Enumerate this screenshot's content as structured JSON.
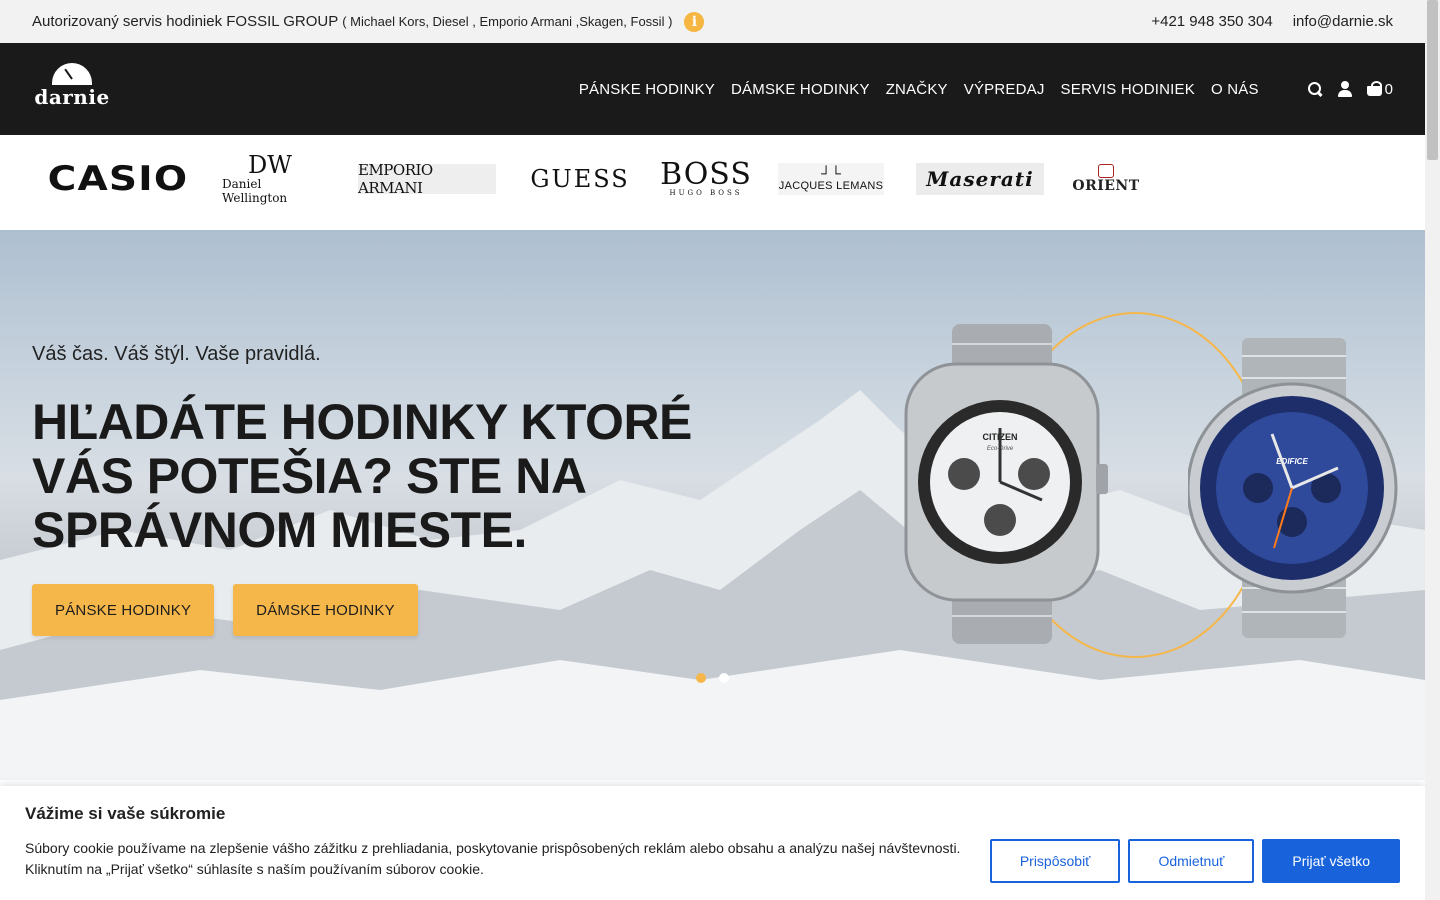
{
  "topbar": {
    "info_main": "Autorizovaný servis hodiniek FOSSIL GROUP",
    "info_brands": "( Michael Kors, Diesel , Emporio Armani ,Skagen, Fossil )",
    "info_icon": "info-icon",
    "phone": "+421 948 350 304",
    "email": "info@darnie.sk"
  },
  "header": {
    "logo_text": "darnie",
    "nav": [
      {
        "label": "PÁNSKE HODINKY"
      },
      {
        "label": "DÁMSKE HODINKY"
      },
      {
        "label": "ZNAČKY"
      },
      {
        "label": "VÝPREDAJ"
      },
      {
        "label": "SERVIS HODINIEK"
      },
      {
        "label": "O NÁS"
      }
    ],
    "icons": [
      "search-icon",
      "user-icon",
      "cart-icon"
    ],
    "cart_count": "0"
  },
  "brands": {
    "casio": "CASIO",
    "dw_mark": "DW",
    "dw_name": "Daniel Wellington",
    "emporio": "EMPORIO ARMANI",
    "guess": "GUESS",
    "boss": "BOSS",
    "boss_sub": "HUGO BOSS",
    "jl_name": "JACQUES LEMANS",
    "maserati": "Maserati",
    "orient": "ORIENT"
  },
  "hero": {
    "tagline": "Váš čas. Váš štýl. Vaše pravidlá.",
    "headline": "HĽADÁTE HODINKY KTORÉ VÁS POTEŠIA? STE NA SPRÁVNOM MIESTE.",
    "btn_men": "PÁNSKE HODINKY",
    "btn_women": "DÁMSKE HODINKY",
    "watch1_brand": "CITIZEN",
    "watch1_sub": "Eco-Drive",
    "watch2_brand": "EDIFICE",
    "slides": 2,
    "active_slide": 1
  },
  "cookie": {
    "title": "Vážime si vaše súkromie",
    "text": "Súbory cookie používame na zlepšenie vášho zážitku z prehliadania, poskytovanie prispôsobených reklám alebo obsahu a analýzu našej návštevnosti. Kliknutím na „Prijať všetko“ súhlasíte s naším používaním súborov cookie.",
    "btn_customize": "Prispôsobiť",
    "btn_reject": "Odmietnuť",
    "btn_accept": "Prijať všetko"
  },
  "colors": {
    "accent": "#f6b74a",
    "header_bg": "#1a1a1a",
    "cookie_blue": "#1863dc"
  }
}
